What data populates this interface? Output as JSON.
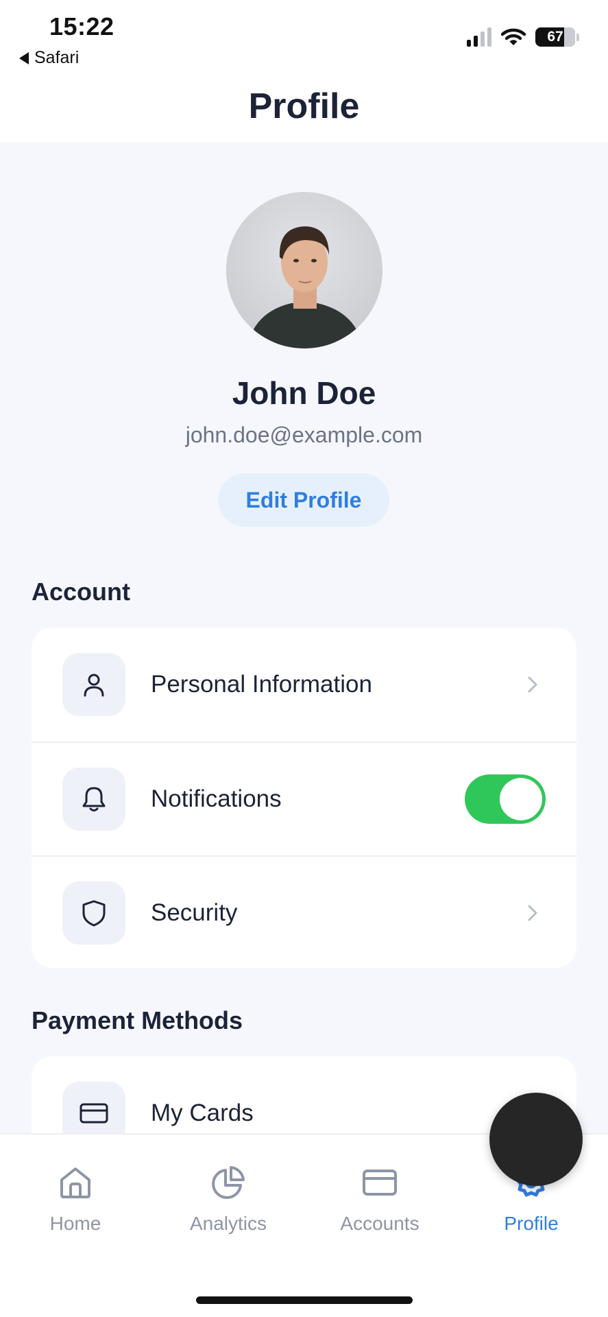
{
  "status_bar": {
    "time": "15:22",
    "back_label": "Safari",
    "battery": "67"
  },
  "header": {
    "title": "Profile"
  },
  "profile": {
    "name": "John Doe",
    "email": "john.doe@example.com",
    "edit_button": "Edit Profile"
  },
  "account": {
    "title": "Account",
    "items": [
      {
        "label": "Personal Information",
        "icon": "person-icon",
        "control": "chevron"
      },
      {
        "label": "Notifications",
        "icon": "bell-icon",
        "control": "toggle",
        "toggle_on": true
      },
      {
        "label": "Security",
        "icon": "shield-icon",
        "control": "chevron"
      }
    ]
  },
  "payment": {
    "title": "Payment Methods",
    "items": [
      {
        "label": "My Cards",
        "icon": "card-icon"
      }
    ]
  },
  "nav": {
    "items": [
      {
        "label": "Home",
        "icon": "home-icon",
        "active": false
      },
      {
        "label": "Analytics",
        "icon": "pie-chart-icon",
        "active": false
      },
      {
        "label": "Accounts",
        "icon": "card-icon",
        "active": false
      },
      {
        "label": "Profile",
        "icon": "settings-icon",
        "active": true
      }
    ]
  },
  "colors": {
    "accent": "#2f7de1",
    "toggle_on": "#30c75a",
    "background": "#f5f7fc",
    "text": "#1c2338",
    "muted": "#8d95a5"
  }
}
